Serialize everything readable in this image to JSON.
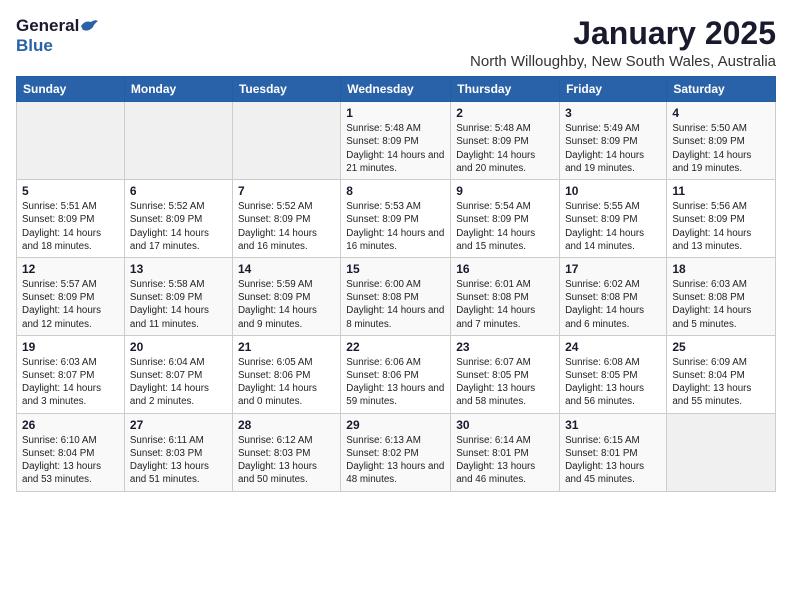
{
  "header": {
    "logo_general": "General",
    "logo_blue": "Blue",
    "month_title": "January 2025",
    "subtitle": "North Willoughby, New South Wales, Australia"
  },
  "weekdays": [
    "Sunday",
    "Monday",
    "Tuesday",
    "Wednesday",
    "Thursday",
    "Friday",
    "Saturday"
  ],
  "weeks": [
    [
      {
        "day": "",
        "info": ""
      },
      {
        "day": "",
        "info": ""
      },
      {
        "day": "",
        "info": ""
      },
      {
        "day": "1",
        "info": "Sunrise: 5:48 AM\nSunset: 8:09 PM\nDaylight: 14 hours\nand 21 minutes."
      },
      {
        "day": "2",
        "info": "Sunrise: 5:48 AM\nSunset: 8:09 PM\nDaylight: 14 hours\nand 20 minutes."
      },
      {
        "day": "3",
        "info": "Sunrise: 5:49 AM\nSunset: 8:09 PM\nDaylight: 14 hours\nand 19 minutes."
      },
      {
        "day": "4",
        "info": "Sunrise: 5:50 AM\nSunset: 8:09 PM\nDaylight: 14 hours\nand 19 minutes."
      }
    ],
    [
      {
        "day": "5",
        "info": "Sunrise: 5:51 AM\nSunset: 8:09 PM\nDaylight: 14 hours\nand 18 minutes."
      },
      {
        "day": "6",
        "info": "Sunrise: 5:52 AM\nSunset: 8:09 PM\nDaylight: 14 hours\nand 17 minutes."
      },
      {
        "day": "7",
        "info": "Sunrise: 5:52 AM\nSunset: 8:09 PM\nDaylight: 14 hours\nand 16 minutes."
      },
      {
        "day": "8",
        "info": "Sunrise: 5:53 AM\nSunset: 8:09 PM\nDaylight: 14 hours\nand 16 minutes."
      },
      {
        "day": "9",
        "info": "Sunrise: 5:54 AM\nSunset: 8:09 PM\nDaylight: 14 hours\nand 15 minutes."
      },
      {
        "day": "10",
        "info": "Sunrise: 5:55 AM\nSunset: 8:09 PM\nDaylight: 14 hours\nand 14 minutes."
      },
      {
        "day": "11",
        "info": "Sunrise: 5:56 AM\nSunset: 8:09 PM\nDaylight: 14 hours\nand 13 minutes."
      }
    ],
    [
      {
        "day": "12",
        "info": "Sunrise: 5:57 AM\nSunset: 8:09 PM\nDaylight: 14 hours\nand 12 minutes."
      },
      {
        "day": "13",
        "info": "Sunrise: 5:58 AM\nSunset: 8:09 PM\nDaylight: 14 hours\nand 11 minutes."
      },
      {
        "day": "14",
        "info": "Sunrise: 5:59 AM\nSunset: 8:09 PM\nDaylight: 14 hours\nand 9 minutes."
      },
      {
        "day": "15",
        "info": "Sunrise: 6:00 AM\nSunset: 8:08 PM\nDaylight: 14 hours\nand 8 minutes."
      },
      {
        "day": "16",
        "info": "Sunrise: 6:01 AM\nSunset: 8:08 PM\nDaylight: 14 hours\nand 7 minutes."
      },
      {
        "day": "17",
        "info": "Sunrise: 6:02 AM\nSunset: 8:08 PM\nDaylight: 14 hours\nand 6 minutes."
      },
      {
        "day": "18",
        "info": "Sunrise: 6:03 AM\nSunset: 8:08 PM\nDaylight: 14 hours\nand 5 minutes."
      }
    ],
    [
      {
        "day": "19",
        "info": "Sunrise: 6:03 AM\nSunset: 8:07 PM\nDaylight: 14 hours\nand 3 minutes."
      },
      {
        "day": "20",
        "info": "Sunrise: 6:04 AM\nSunset: 8:07 PM\nDaylight: 14 hours\nand 2 minutes."
      },
      {
        "day": "21",
        "info": "Sunrise: 6:05 AM\nSunset: 8:06 PM\nDaylight: 14 hours\nand 0 minutes."
      },
      {
        "day": "22",
        "info": "Sunrise: 6:06 AM\nSunset: 8:06 PM\nDaylight: 13 hours\nand 59 minutes."
      },
      {
        "day": "23",
        "info": "Sunrise: 6:07 AM\nSunset: 8:05 PM\nDaylight: 13 hours\nand 58 minutes."
      },
      {
        "day": "24",
        "info": "Sunrise: 6:08 AM\nSunset: 8:05 PM\nDaylight: 13 hours\nand 56 minutes."
      },
      {
        "day": "25",
        "info": "Sunrise: 6:09 AM\nSunset: 8:04 PM\nDaylight: 13 hours\nand 55 minutes."
      }
    ],
    [
      {
        "day": "26",
        "info": "Sunrise: 6:10 AM\nSunset: 8:04 PM\nDaylight: 13 hours\nand 53 minutes."
      },
      {
        "day": "27",
        "info": "Sunrise: 6:11 AM\nSunset: 8:03 PM\nDaylight: 13 hours\nand 51 minutes."
      },
      {
        "day": "28",
        "info": "Sunrise: 6:12 AM\nSunset: 8:03 PM\nDaylight: 13 hours\nand 50 minutes."
      },
      {
        "day": "29",
        "info": "Sunrise: 6:13 AM\nSunset: 8:02 PM\nDaylight: 13 hours\nand 48 minutes."
      },
      {
        "day": "30",
        "info": "Sunrise: 6:14 AM\nSunset: 8:01 PM\nDaylight: 13 hours\nand 46 minutes."
      },
      {
        "day": "31",
        "info": "Sunrise: 6:15 AM\nSunset: 8:01 PM\nDaylight: 13 hours\nand 45 minutes."
      },
      {
        "day": "",
        "info": ""
      }
    ]
  ]
}
